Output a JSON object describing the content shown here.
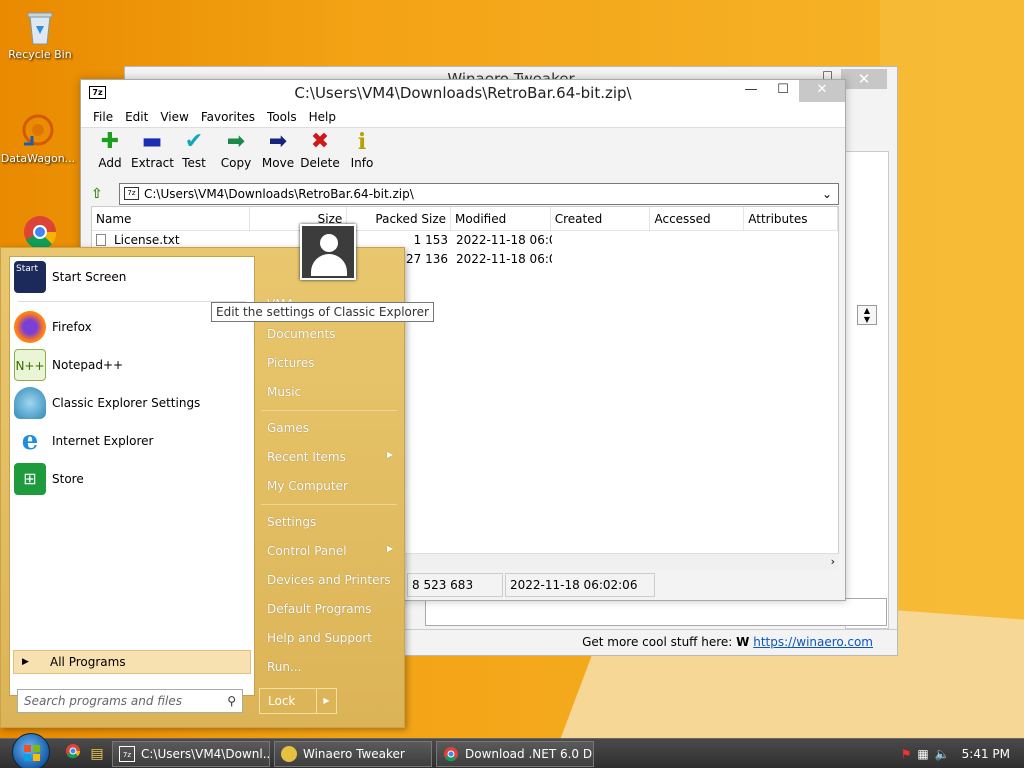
{
  "desktop": {
    "icons": [
      {
        "label": "Recycle Bin",
        "icon": "recycle-bin-icon"
      },
      {
        "label": "DataWagon...",
        "icon": "datawagon-icon"
      }
    ]
  },
  "winaero": {
    "title": "Winaero Tweaker",
    "footer_text": "Get more cool stuff here:",
    "footer_logo": "W",
    "footer_link": "https://winaero.com"
  },
  "sevenzip": {
    "title": "C:\\Users\\VM4\\Downloads\\RetroBar.64-bit.zip\\",
    "app_icon": "7z",
    "menu": [
      "File",
      "Edit",
      "View",
      "Favorites",
      "Tools",
      "Help"
    ],
    "toolbar": [
      {
        "label": "Add",
        "icon": "add-icon",
        "glyph": "✚",
        "color": "#1e9e1e"
      },
      {
        "label": "Extract",
        "icon": "extract-icon",
        "glyph": "▬",
        "color": "#1a2fb0"
      },
      {
        "label": "Test",
        "icon": "test-icon",
        "glyph": "✔",
        "color": "#15a7b9"
      },
      {
        "label": "Copy",
        "icon": "copy-icon",
        "glyph": "➡",
        "color": "#1a8a4a"
      },
      {
        "label": "Move",
        "icon": "move-icon",
        "glyph": "➡",
        "color": "#13237e"
      },
      {
        "label": "Delete",
        "icon": "delete-icon",
        "glyph": "✖",
        "color": "#d01818"
      },
      {
        "label": "Info",
        "icon": "info-icon",
        "glyph": "i",
        "color": "#b7a200"
      }
    ],
    "address": "C:\\Users\\VM4\\Downloads\\RetroBar.64-bit.zip\\",
    "columns": [
      "Name",
      "Size",
      "Packed Size",
      "Modified",
      "Created",
      "Accessed",
      "Attributes"
    ],
    "rows": [
      {
        "name": "License.txt",
        "size": "",
        "packed": "1 153",
        "modified": "2022-11-18 06:02"
      },
      {
        "name": "",
        "size": "",
        "packed": "727 136",
        "modified": "2022-11-18 06:02"
      }
    ],
    "status": {
      "size": "8 523 683",
      "date": "2022-11-18 06:02:06"
    }
  },
  "start_menu": {
    "pinned": [
      {
        "label": "Start Screen",
        "icon": "start-screen-icon"
      },
      {
        "label": "Firefox",
        "icon": "firefox-icon"
      },
      {
        "label": "Notepad++",
        "icon": "notepadpp-icon"
      },
      {
        "label": "Classic Explorer Settings",
        "icon": "classic-explorer-icon"
      },
      {
        "label": "Internet Explorer",
        "icon": "internet-explorer-icon"
      },
      {
        "label": "Store",
        "icon": "store-icon"
      }
    ],
    "start_screen_badge": "Start",
    "all_programs": "All Programs",
    "search_placeholder": "Search programs and files",
    "user": "VM4",
    "right_items": [
      {
        "label": "Documents",
        "has_arrow": false
      },
      {
        "label": "Pictures",
        "has_arrow": false
      },
      {
        "label": "Music",
        "has_arrow": false
      },
      {
        "label": "Games",
        "has_arrow": false
      },
      {
        "label": "Recent Items",
        "has_arrow": true
      },
      {
        "label": "My Computer",
        "has_arrow": false
      },
      {
        "label": "Settings",
        "has_arrow": false
      },
      {
        "label": "Control Panel",
        "has_arrow": true
      },
      {
        "label": "Devices and Printers",
        "has_arrow": false
      },
      {
        "label": "Default Programs",
        "has_arrow": false
      },
      {
        "label": "Help and Support",
        "has_arrow": false
      },
      {
        "label": "Run...",
        "has_arrow": false
      }
    ],
    "lock_label": "Lock",
    "tooltip": "Edit the settings of Classic Explorer"
  },
  "taskbar": {
    "tasks": [
      {
        "label": "C:\\Users\\VM4\\Downl...",
        "icon": "7zip-icon"
      },
      {
        "label": "Winaero Tweaker",
        "icon": "winaero-icon"
      },
      {
        "label": "Download .NET 6.0 D...",
        "icon": "chrome-icon"
      }
    ],
    "clock": "5:41 PM"
  }
}
